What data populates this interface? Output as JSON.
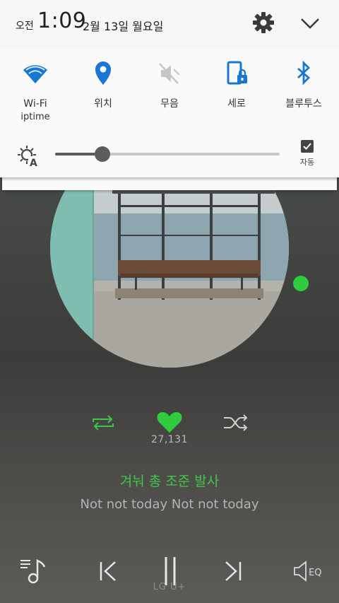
{
  "status": {
    "ampm": "오전",
    "time": "1:09",
    "date": "2월 13일 월요일"
  },
  "quick_settings": [
    {
      "label": "Wi-Fi",
      "sub": "iptime",
      "icon": "wifi-icon",
      "active": true
    },
    {
      "label": "위치",
      "icon": "location-icon",
      "active": true
    },
    {
      "label": "무음",
      "icon": "mute-icon",
      "active": false
    },
    {
      "label": "세로",
      "icon": "portrait-lock-icon",
      "active": true
    },
    {
      "label": "블루투스",
      "icon": "bluetooth-icon",
      "active": true
    }
  ],
  "brightness": {
    "level": 0.21,
    "auto_label": "자동",
    "auto_checked": true
  },
  "player": {
    "like_count": "27,131",
    "title": "겨눠 총 조준 발사",
    "lyric": "Not not today Not not today",
    "carrier": "LG U+",
    "controls": [
      "repeat-icon",
      "heart-icon",
      "shuffle-icon",
      "playlist-icon",
      "previous-icon",
      "pause-icon",
      "next-icon",
      "equalizer-icon"
    ]
  },
  "colors": {
    "accent_blue": "#1976d2",
    "accent_green": "#2fcd3b",
    "lyric_green": "#3ec84a"
  }
}
